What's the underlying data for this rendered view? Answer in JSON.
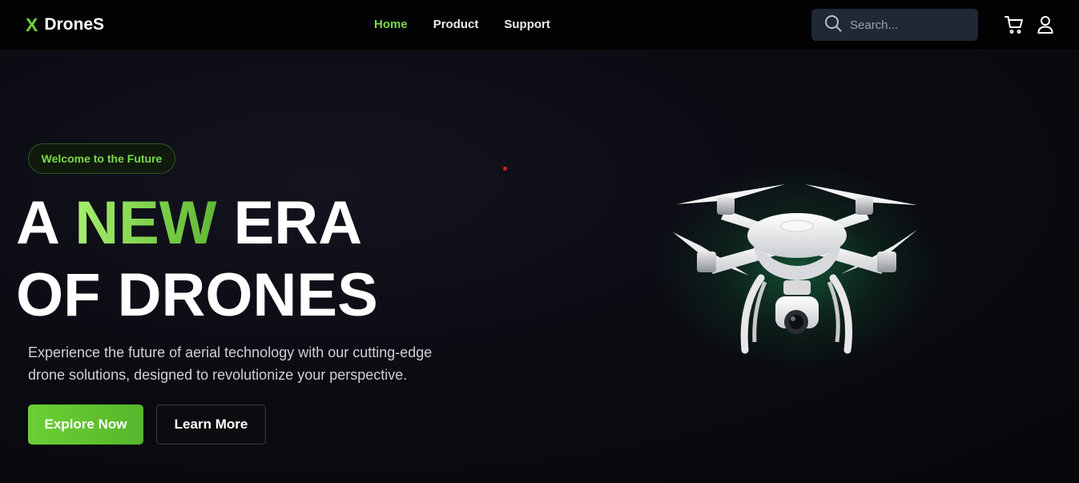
{
  "nav": {
    "logo_mark": "X",
    "logo_text": "DroneS",
    "links": [
      {
        "label": "Home",
        "active": true
      },
      {
        "label": "Product",
        "active": false
      },
      {
        "label": "Support",
        "active": false
      }
    ],
    "search_placeholder": "Search...",
    "icons": [
      "search-icon",
      "cart-icon",
      "user-icon"
    ]
  },
  "hero": {
    "badge": "Welcome to the Future",
    "headline_line1_pre": "A ",
    "headline_line1_accent": "NEW",
    "headline_line1_post": " ERA",
    "headline_line2": "OF DRONES",
    "subtext_line1": "Experience the future of aerial technology with our cutting-edge",
    "subtext_line2": "drone solutions, designed to revolutionize your perspective.",
    "primary_button": "Explore Now",
    "secondary_button": "Learn More"
  },
  "colors": {
    "accent": "#6fd13c",
    "background": "#0a0a10",
    "navbar": "#020203",
    "search_bg": "#1f2833"
  }
}
